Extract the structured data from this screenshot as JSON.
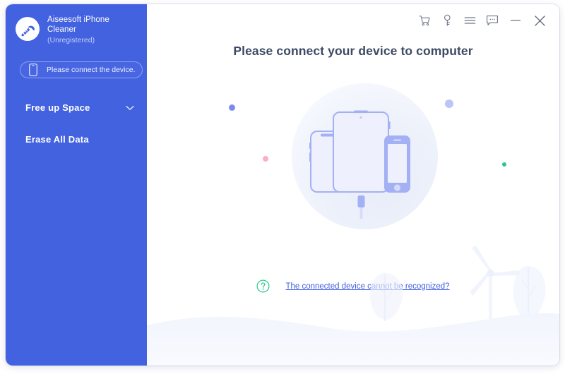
{
  "window": {
    "titlebar_buttons": [
      {
        "name": "cart-icon",
        "label": "Cart"
      },
      {
        "name": "key-icon",
        "label": "Register"
      },
      {
        "name": "menu-icon",
        "label": "Menu"
      },
      {
        "name": "feedback-icon",
        "label": "Feedback"
      },
      {
        "name": "minimize-icon",
        "label": "Minimize"
      },
      {
        "name": "close-icon",
        "label": "Close"
      }
    ]
  },
  "sidebar": {
    "brand_name": "Aiseesoft iPhone Cleaner",
    "brand_status": "(Unregistered)",
    "logo_icon": "broom-icon",
    "connect_button": {
      "label": "Please connect the device.",
      "icon": "phone-icon"
    },
    "items": [
      {
        "label": "Free up Space",
        "icon": "chevron-down-icon",
        "expandable": true
      },
      {
        "label": "Erase All Data",
        "icon": "",
        "expandable": false
      }
    ],
    "background_color": "#4362e0"
  },
  "main": {
    "headline": "Please connect your device to computer",
    "illustration": {
      "devices": [
        "iphone-x",
        "ipad",
        "iphone-home"
      ],
      "connector": "lightning-connector",
      "background_shape": "circle"
    },
    "help": {
      "icon": "question-mark-icon",
      "link_text": "The connected device cannot be recognized?",
      "link_color": "#3f5fe0",
      "icon_color": "#2ecc8f"
    },
    "decorations": {
      "dots": [
        {
          "name": "dot-blue-purple",
          "color": "#7b8cf0"
        },
        {
          "name": "dot-pink",
          "color": "#fcaec6"
        },
        {
          "name": "dot-light-blue",
          "color": "#b9c6f7"
        },
        {
          "name": "dot-green",
          "color": "#24c98a"
        }
      ],
      "landscape": [
        "hill",
        "tree-left",
        "windmill",
        "tree-right"
      ]
    }
  }
}
